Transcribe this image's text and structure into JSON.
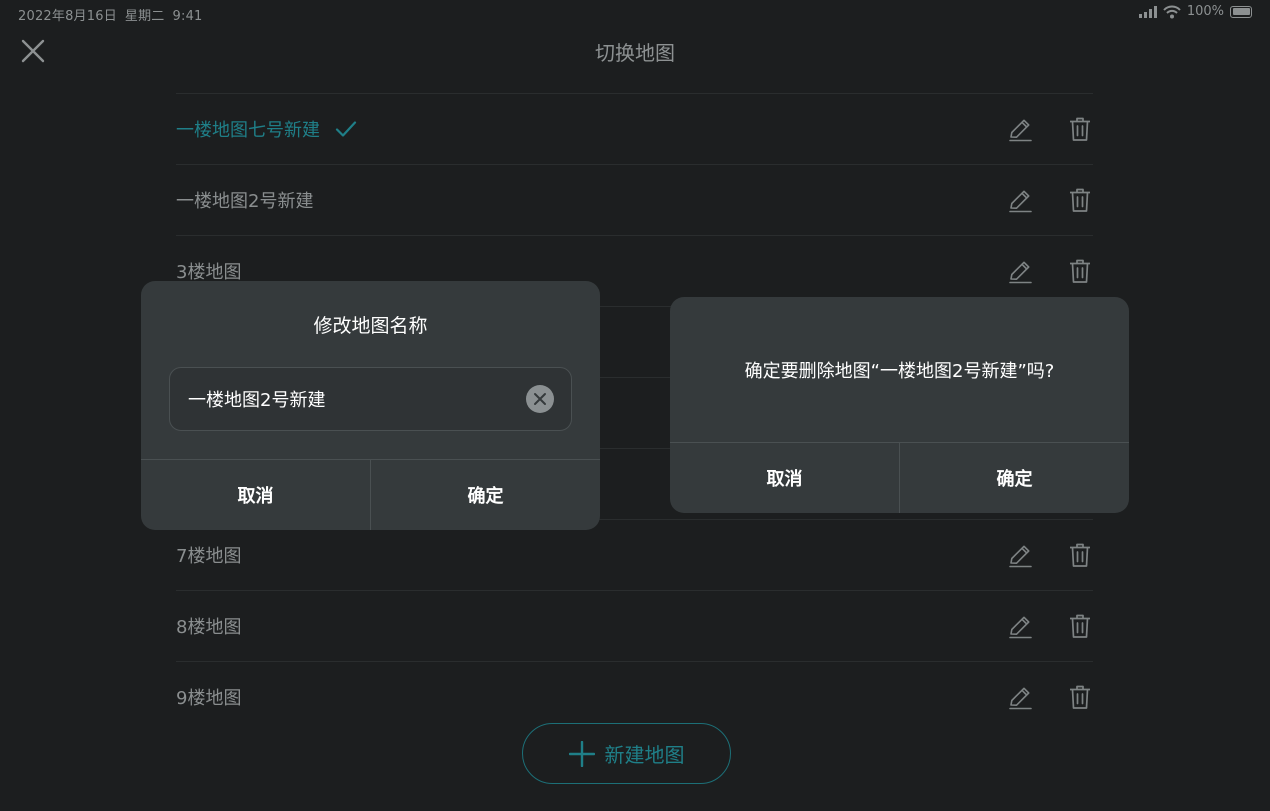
{
  "status_bar": {
    "date": "2022年8月16日",
    "weekday": "星期二",
    "time": "9:41",
    "battery": "100%"
  },
  "header": {
    "title": "切换地图"
  },
  "maps": [
    {
      "name": "一楼地图七号新建",
      "active": true
    },
    {
      "name": "一楼地图2号新建",
      "active": false
    },
    {
      "name": "3楼地图",
      "active": false
    },
    {
      "name": "",
      "active": false
    },
    {
      "name": "",
      "active": false
    },
    {
      "name": "",
      "active": false
    },
    {
      "name": "7楼地图",
      "active": false
    },
    {
      "name": "8楼地图",
      "active": false
    },
    {
      "name": "9楼地图",
      "active": false
    }
  ],
  "new_map_label": "新建地图",
  "rename_dialog": {
    "title": "修改地图名称",
    "input_value": "一楼地图2号新建",
    "cancel_label": "取消",
    "confirm_label": "确定"
  },
  "delete_dialog": {
    "message": "确定要删除地图“一楼地图2号新建”吗?",
    "cancel_label": "取消",
    "confirm_label": "确定"
  },
  "colors": {
    "background": "#1c1e1f",
    "accent": "#1f7f88",
    "dialog": "#353a3c"
  }
}
